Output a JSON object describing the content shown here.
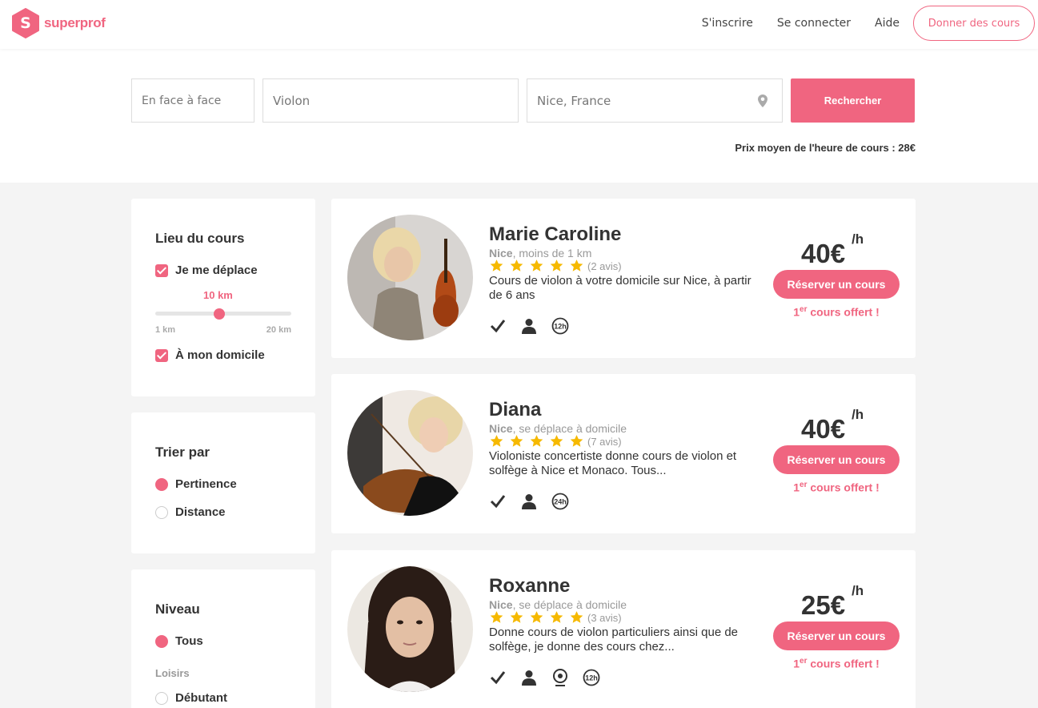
{
  "header": {
    "brand": "superprof",
    "logo_letter": "S",
    "nav": [
      "S'inscrire",
      "Se connecter",
      "Aide"
    ],
    "cta": "Donner des cours"
  },
  "search": {
    "mode": "En face à face",
    "subject": "Violon",
    "location": "Nice, France",
    "button": "Rechercher",
    "avg_price": "Prix moyen de l'heure de cours : 28€"
  },
  "filters": {
    "lieu": {
      "title": "Lieu du cours",
      "travel_label": "Je me déplace",
      "distance": "10 km",
      "distance_fraction": 0.47,
      "min": "1 km",
      "max": "20 km",
      "home_label": "À mon domicile"
    },
    "sort": {
      "title": "Trier par",
      "options": [
        "Pertinence",
        "Distance"
      ],
      "selected": "Pertinence"
    },
    "level": {
      "title": "Niveau",
      "all": "Tous",
      "group": "Loisirs",
      "beginner": "Débutant"
    }
  },
  "results": [
    {
      "name": "Marie Caroline",
      "city": "Nice",
      "distance": ", moins de 1 km",
      "rating": 5,
      "reviews": "(2 avis)",
      "description": "Cours de violon à votre domicile sur Nice, à partir de 6 ans",
      "price": "40€",
      "unit": "/h",
      "book": "Réserver un cours",
      "offer_num": "1",
      "offer_sup": "er",
      "offer_text": " cours offert !",
      "badge": "12h"
    },
    {
      "name": "Diana",
      "city": "Nice",
      "distance": ", se déplace à domicile",
      "rating": 5,
      "reviews": "(7 avis)",
      "description": "Violoniste concertiste donne cours de violon et solfège à Nice et Monaco. Tous...",
      "price": "40€",
      "unit": "/h",
      "book": "Réserver un cours",
      "offer_num": "1",
      "offer_sup": "er",
      "offer_text": " cours offert !",
      "badge": "24h"
    },
    {
      "name": "Roxanne",
      "city": "Nice",
      "distance": ", se déplace à domicile",
      "rating": 5,
      "reviews": "(3 avis)",
      "description": "Donne cours de violon particuliers ainsi que de solfège, je donne des cours chez...",
      "price": "25€",
      "unit": "/h",
      "book": "Réserver un cours",
      "offer_num": "1",
      "offer_sup": "er",
      "offer_text": " cours offert !",
      "badge": "12h"
    }
  ],
  "colors": {
    "accent": "#f06580",
    "star": "#f6b900"
  }
}
